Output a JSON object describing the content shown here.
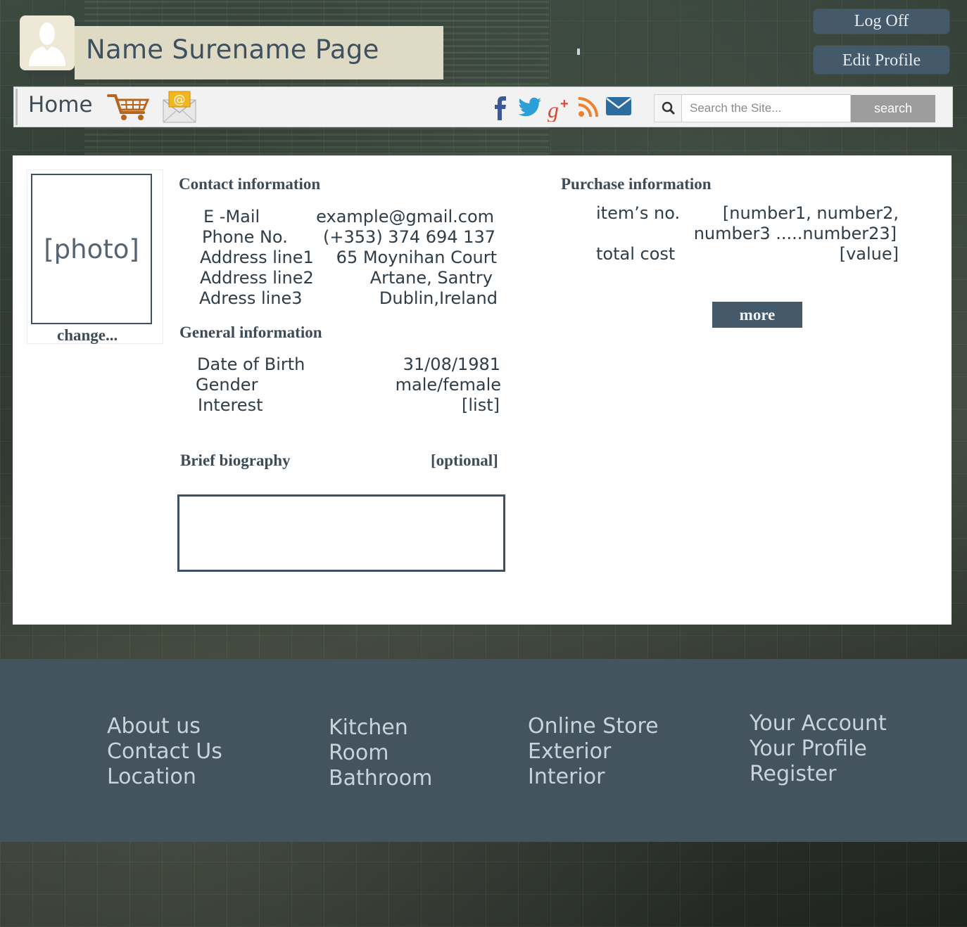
{
  "header": {
    "title": "Name Surename Page",
    "logoff_label": "Log Off",
    "edit_profile_label": "Edit Profile"
  },
  "nav": {
    "home_label": "Home",
    "search": {
      "placeholder": "Search the Site...",
      "button_label": "search"
    }
  },
  "profile": {
    "photo_placeholder": "[photo]",
    "change_label": "change..."
  },
  "contact": {
    "title": "Contact information",
    "rows": [
      {
        "label": "E -Mail",
        "value": "example@gmail.com"
      },
      {
        "label": "Phone No.",
        "value": "(+353) 374 694 137"
      },
      {
        "label": "Address line1",
        "value": "65 Moynihan Court"
      },
      {
        "label": "Address line2",
        "value": "Artane, Santry"
      },
      {
        "label": "Adress line3",
        "value": "Dublin,Ireland"
      }
    ]
  },
  "general": {
    "title": "General information",
    "rows": [
      {
        "label": "Date of Birth",
        "value": "31/08/1981"
      },
      {
        "label": "Gender",
        "value": "male/female"
      },
      {
        "label": "Interest",
        "value": "[list]"
      }
    ]
  },
  "bio": {
    "title": "Brief biography",
    "note": "[optional]"
  },
  "purchase": {
    "title": "Purchase information",
    "items_label": "item’s no.",
    "items_value_line1": "[number1, number2,",
    "items_value_line2": "number3 .....number23]",
    "total_label": "total cost",
    "total_value": "[value]",
    "more_label": "more"
  },
  "footer": {
    "col1": [
      "About us",
      "Contact Us",
      "Location"
    ],
    "col2": [
      "Kitchen",
      "Room",
      "Bathroom"
    ],
    "col3": [
      "Online Store",
      "Exterior",
      "Interior"
    ],
    "col4": [
      "Your Account",
      "Your Profile",
      "Register"
    ]
  },
  "colors": {
    "accent": "#44596a",
    "title_bg": "#dedac4",
    "footer_bg": "#44545f"
  }
}
